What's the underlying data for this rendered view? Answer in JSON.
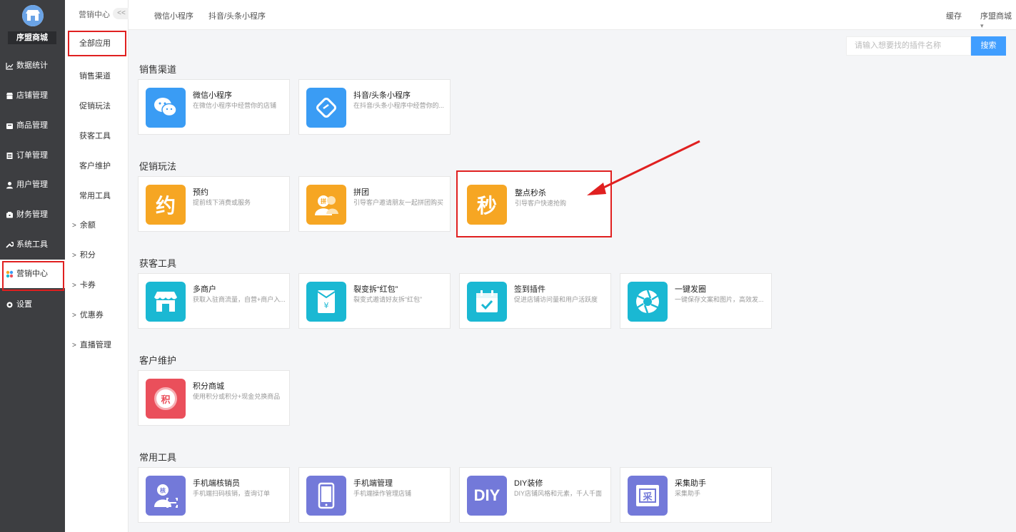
{
  "sidebar": {
    "store_name": "序盟商城",
    "items": [
      {
        "label": "数据统计",
        "icon": "chart-icon"
      },
      {
        "label": "店铺管理",
        "icon": "store-icon"
      },
      {
        "label": "商品管理",
        "icon": "goods-icon"
      },
      {
        "label": "订单管理",
        "icon": "order-icon"
      },
      {
        "label": "用户管理",
        "icon": "user-icon"
      },
      {
        "label": "财务管理",
        "icon": "finance-icon"
      },
      {
        "label": "系统工具",
        "icon": "wrench-icon"
      },
      {
        "label": "营销中心",
        "icon": "marketing-icon"
      },
      {
        "label": "设置",
        "icon": "gear-icon"
      }
    ]
  },
  "subnav": {
    "title": "营销中心",
    "collapse": "<<",
    "items": [
      "全部应用",
      "销售渠道",
      "促销玩法",
      "获客工具",
      "客户维护",
      "常用工具"
    ],
    "groups": [
      "余额",
      "积分",
      "卡券",
      "优惠券",
      "直播管理"
    ]
  },
  "topbar": {
    "tabs": [
      "微信小程序",
      "抖音/头条小程序"
    ],
    "cache": "缓存",
    "user": "序盟商城"
  },
  "search": {
    "placeholder": "请输入想要找的插件名称",
    "button": "搜索"
  },
  "sections": [
    {
      "title": "销售渠道",
      "cards": [
        {
          "name": "微信小程序",
          "desc": "在微信小程序中经营你的店铺",
          "color": "#3a9cf4",
          "icon": "wechat-icon"
        },
        {
          "name": "抖音/头条小程序",
          "desc": "在抖音/头条小程序中经营你的...",
          "color": "#3a9cf4",
          "icon": "link-icon"
        }
      ]
    },
    {
      "title": "促销玩法",
      "cards": [
        {
          "name": "预约",
          "desc": "提前线下消费或服务",
          "color": "#f6a623",
          "glyph": "约"
        },
        {
          "name": "拼团",
          "desc": "引导客户邀请朋友一起拼团购买",
          "color": "#f6a623",
          "icon": "group-icon"
        },
        {
          "name": "整点秒杀",
          "desc": "引导客户快速抢购",
          "color": "#f6a623",
          "glyph": "秒"
        }
      ]
    },
    {
      "title": "获客工具",
      "cards": [
        {
          "name": "多商户",
          "desc": "获取入驻商流量，自营+商户入...",
          "color": "#1ab8d3",
          "icon": "shop-icon"
        },
        {
          "name": "裂变拆“红包”",
          "desc": "裂变式邀请好友拆“红包”",
          "color": "#1ab8d3",
          "icon": "redpacket-icon"
        },
        {
          "name": "签到插件",
          "desc": "促进店铺访问量和用户活跃度",
          "color": "#1ab8d3",
          "icon": "calendar-icon"
        },
        {
          "name": "一键发圈",
          "desc": "一键保存文案和图片，高效发...",
          "color": "#1ab8d3",
          "icon": "aperture-icon"
        }
      ]
    },
    {
      "title": "客户维护",
      "cards": [
        {
          "name": "积分商城",
          "desc": "使用积分或积分+现金兑换商品",
          "color": "#ea4f5b",
          "glyph": "积"
        }
      ]
    },
    {
      "title": "常用工具",
      "cards": [
        {
          "name": "手机端核销员",
          "desc": "手机端扫码核销，查询订单",
          "color": "#7379d9",
          "icon": "verifier-icon"
        },
        {
          "name": "手机端管理",
          "desc": "手机端操作管理店铺",
          "color": "#7379d9",
          "icon": "phone-icon"
        },
        {
          "name": "DIY装修",
          "desc": "DIY店铺风格和元素，千人千面",
          "color": "#7379d9",
          "glyph": "DIY"
        },
        {
          "name": "采集助手",
          "desc": "采集助手",
          "color": "#7379d9",
          "glyph": "采"
        }
      ]
    }
  ]
}
